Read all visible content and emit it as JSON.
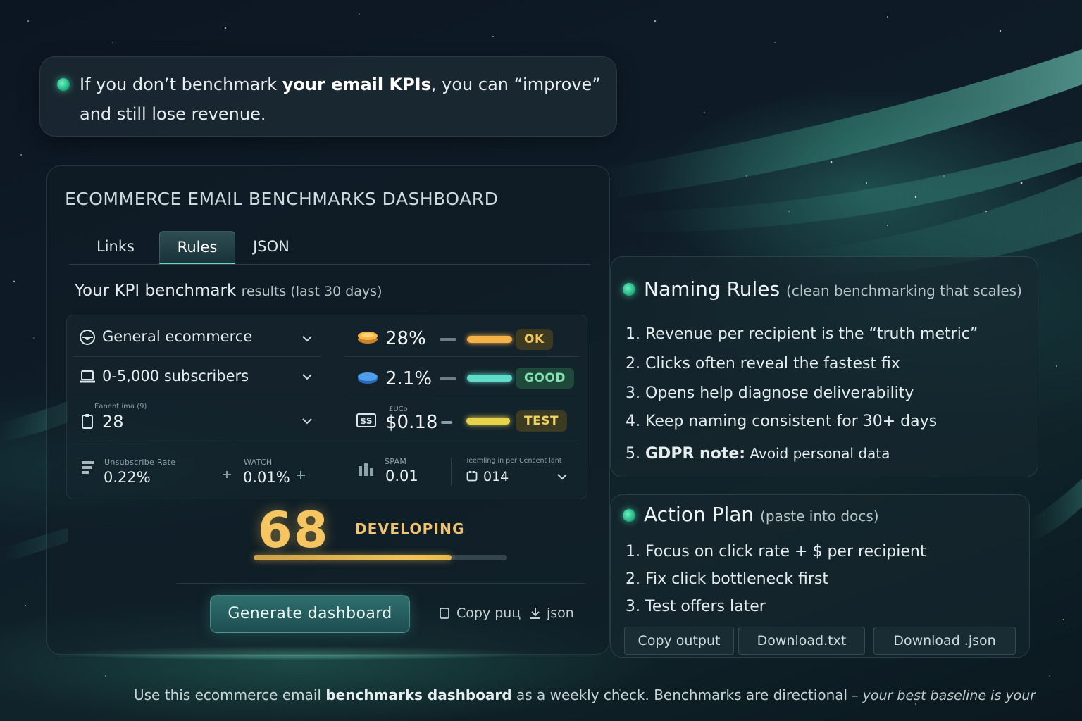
{
  "callout": {
    "part1": "If you don’t benchmark ",
    "bold": "your email KPIs",
    "part2": ", you can “improve” and still lose revenue."
  },
  "dashboard": {
    "title": "ECOMMERCE EMAIL BENCHMARKS DASHBOARD",
    "tabs": [
      {
        "label": "Links",
        "active": false
      },
      {
        "label": "Rules",
        "active": true
      },
      {
        "label": "JSON",
        "active": false
      }
    ],
    "results_heading": "Your KPI benchmark",
    "results_sub": "results (last 30 days)",
    "selectors": {
      "industry": {
        "value": "General ecommerce",
        "icon": "storefront-icon"
      },
      "list_size": {
        "value": "0-5,000 subscribers",
        "icon": "laptop-icon"
      },
      "emails": {
        "tiny_label": "Eanent ima (9)",
        "value": "28",
        "icon": "clipboard-icon"
      }
    },
    "kpis": [
      {
        "value": "28%",
        "status": "OK",
        "icon": "coin-stack-icon",
        "bar_color": "#f5b04a",
        "badge_bg": "#3d3a22",
        "badge_color": "#f3c45b",
        "tiny_label": ""
      },
      {
        "value": "2.1%",
        "status": "GOOD",
        "icon": "blue-disc-icon",
        "bar_color": "#5fdcc9",
        "badge_bg": "#1f4a3b",
        "badge_color": "#7fe0b0",
        "tiny_label": ""
      },
      {
        "value": "$0.18",
        "status": "TEST",
        "icon": "dollar-card-icon",
        "bar_color": "#e6d34a",
        "badge_bg": "#3c3a20",
        "badge_color": "#f1d45a",
        "tiny_label": "£UCo"
      }
    ],
    "mini_metrics": [
      {
        "label": "Unsubscribe Rate",
        "value": "0.22%",
        "icon": "list-icon"
      },
      {
        "label": "WATCH",
        "value": "0.01%",
        "icon": "small-sparkle-icon"
      },
      {
        "label": "SPAM",
        "value": "0.01",
        "icon": "bars-icon"
      },
      {
        "label": "Teemling in per Cencent lant",
        "value": "014",
        "icon": "calendar-icon"
      }
    ],
    "score": {
      "value": "68",
      "state": "DEVELOPING",
      "progress": 0.78
    },
    "generate_label": "Generate dashboard",
    "copy_label": "Copy puц",
    "json_label": "json"
  },
  "naming_rules": {
    "title": "Naming Rules",
    "subtitle": "(clean benchmarking that scales)",
    "items": [
      {
        "num": "1.",
        "text": "Revenue per recipient is the “truth metric”"
      },
      {
        "num": "2.",
        "text": "Clicks often reveal the fastest fix"
      },
      {
        "num": "3.",
        "text": "Opens help diagnose deliverability"
      },
      {
        "num": "4.",
        "text": "Keep naming consistent for 30+ days"
      }
    ],
    "gdpr_num": "5.",
    "gdpr_bold": "GDPR note:",
    "gdpr_text": " Avoid personal data"
  },
  "action_plan": {
    "title": "Action Plan",
    "subtitle": "(paste into docs)",
    "items": [
      {
        "num": "1.",
        "text": "Focus on click rate + $ per recipient"
      },
      {
        "num": "2.",
        "text": "Fix click bottleneck first"
      },
      {
        "num": "3.",
        "text": "Test offers later"
      }
    ],
    "buttons": [
      "Copy output",
      "Download.txt",
      "Download .json"
    ]
  },
  "footer": {
    "part1": "Use this ecommerce email ",
    "bold": "benchmarks dashboard",
    "part2": " as a weekly check. Benchmarks are directional",
    "italic": " – your best baseline is your"
  }
}
